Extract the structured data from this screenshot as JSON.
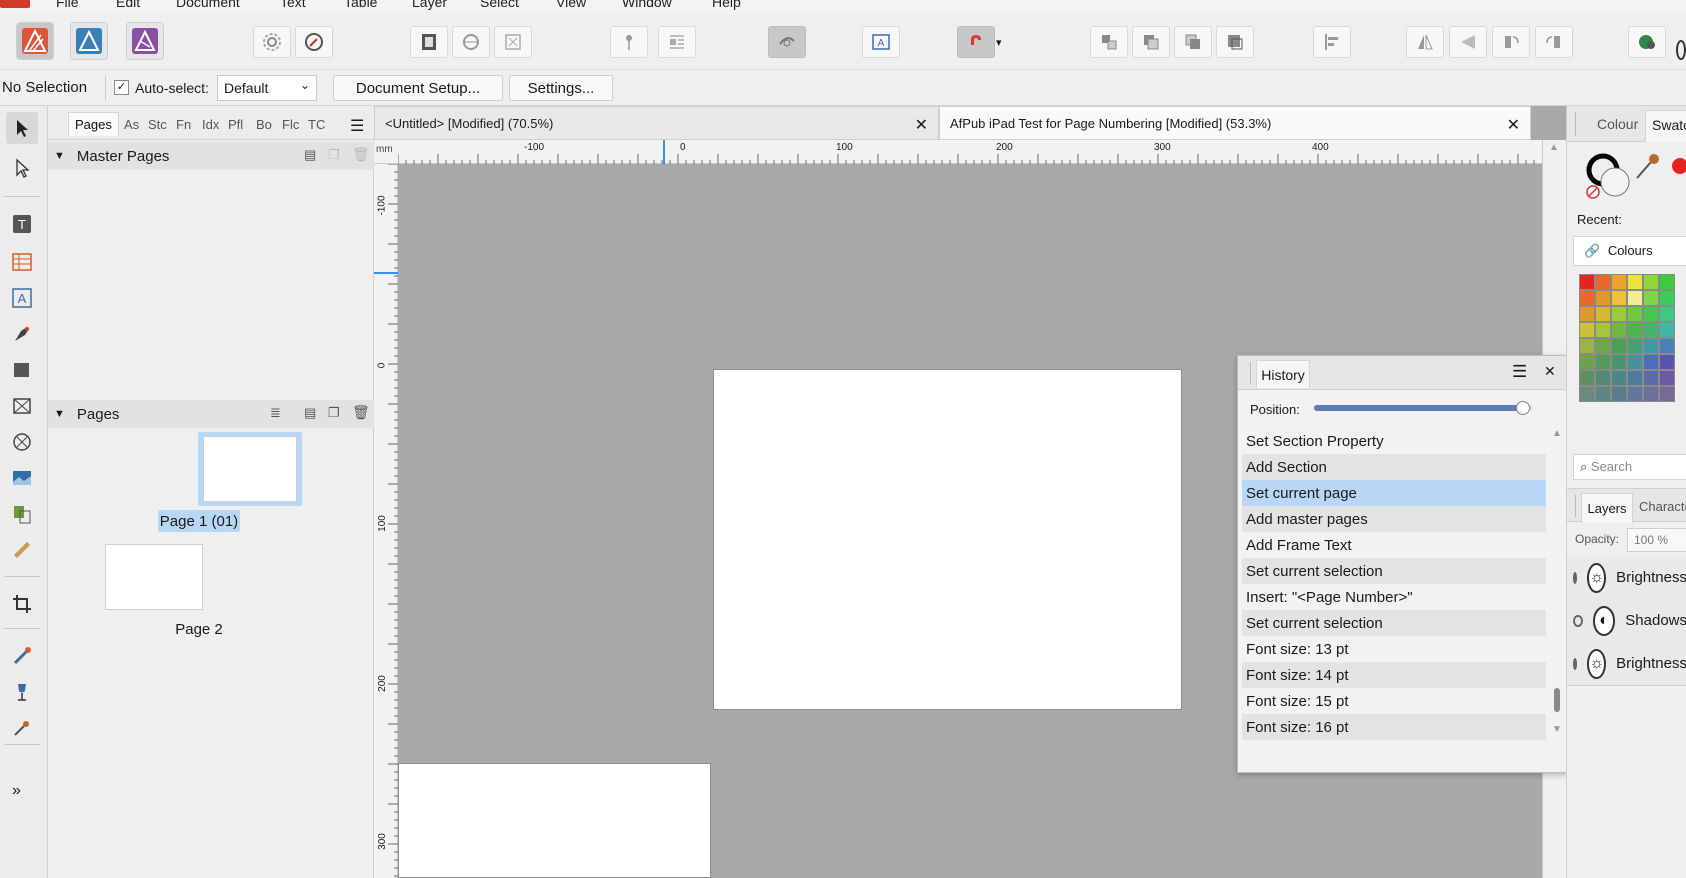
{
  "menu": [
    "File",
    "Edit",
    "Document",
    "Text",
    "Table",
    "Layer",
    "Select",
    "View",
    "Window",
    "Help"
  ],
  "context_bar": {
    "selection": "No Selection",
    "auto_select_label": "Auto-select:",
    "auto_select_value": "Default",
    "document_setup": "Document Setup...",
    "settings": "Settings..."
  },
  "left_panel": {
    "tabs": [
      "Pages",
      "As",
      "Stc",
      "Fn",
      "Idx",
      "Pfl",
      "Bo",
      "Flc",
      "TC"
    ],
    "master_pages_title": "Master Pages",
    "pages_title": "Pages",
    "pages": [
      {
        "label": "Page 1 (01)"
      },
      {
        "label": "Page 2"
      }
    ]
  },
  "document_tabs": [
    {
      "title": "<Untitled> [Modified] (70.5%)"
    },
    {
      "title": "AfPub iPad Test for Page Numbering [Modified] (53.3%)"
    }
  ],
  "ruler": {
    "unit": "mm",
    "h_labels": [
      "-100",
      "0",
      "100",
      "200",
      "300",
      "400"
    ],
    "v_labels": [
      "-100",
      "0",
      "100",
      "200",
      "300"
    ]
  },
  "history": {
    "title": "History",
    "position_label": "Position:",
    "position_value": 0.96,
    "items": [
      "Set Section Property",
      "Add Section",
      "Set current page",
      "Add master pages",
      "Add Frame Text",
      "Set current selection",
      "Insert: \"<Page Number>\"",
      "Set current selection",
      "Font size: 13 pt",
      "Font size: 14 pt",
      "Font size: 15 pt",
      "Font size: 16 pt"
    ],
    "selected_index": 2
  },
  "right_panel": {
    "tabs": [
      "Colour",
      "Swatches"
    ],
    "recent_label": "Recent:",
    "palette_name": "Colours",
    "search_placeholder": "Search",
    "layer_tabs": [
      "Layers",
      "Character"
    ],
    "opacity_label": "Opacity:",
    "opacity_value": "100 %",
    "layers": [
      "Brightness",
      "Shadows",
      "Brightness"
    ]
  },
  "colors": {
    "accent_selection": "#b8d6f5",
    "slider": "#5b7fb5",
    "canvas": "#a9a9a9"
  }
}
